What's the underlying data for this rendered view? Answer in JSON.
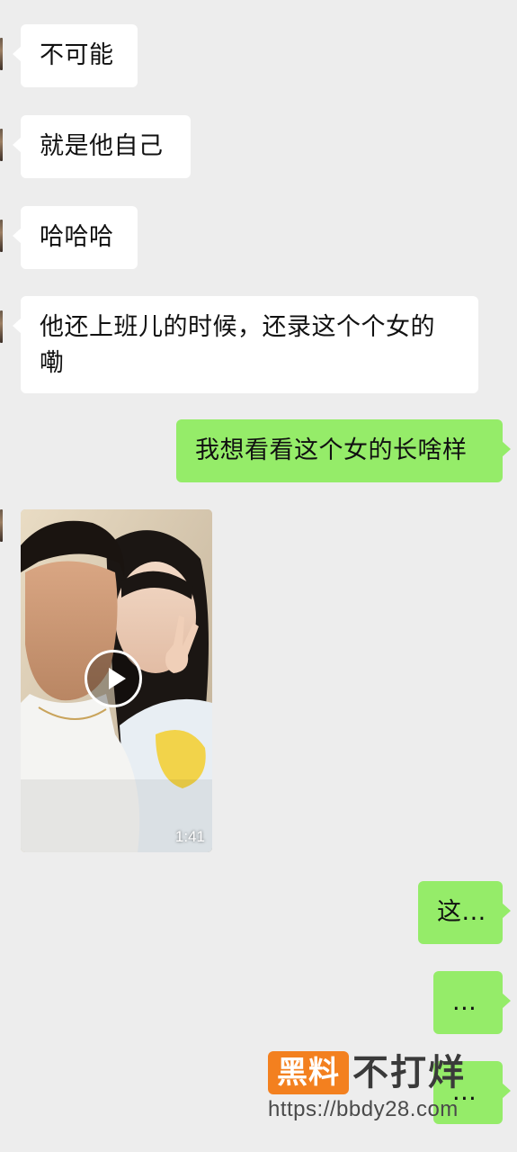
{
  "messages": [
    {
      "from": "other",
      "text": "不可能"
    },
    {
      "from": "other",
      "text": "就是他自己"
    },
    {
      "from": "other",
      "text": "哈哈哈"
    },
    {
      "from": "other",
      "text": "他还上班儿的时候，还录这个个女的嘞"
    },
    {
      "from": "me",
      "text": "我想看看这个女的长啥样"
    },
    {
      "from": "other",
      "type": "video",
      "duration": "1:41"
    },
    {
      "from": "me",
      "text": "这..."
    },
    {
      "from": "me",
      "text": "..."
    },
    {
      "from": "me",
      "text": "..."
    }
  ],
  "watermark": {
    "badge": "黑料",
    "title": "不打烊",
    "url": "https://bbdy28.com"
  },
  "colors": {
    "background": "#ededed",
    "incoming_bubble": "#ffffff",
    "outgoing_bubble": "#95ec69",
    "watermark_badge": "#f3801f"
  },
  "icons": {
    "video_play": "play-icon"
  }
}
